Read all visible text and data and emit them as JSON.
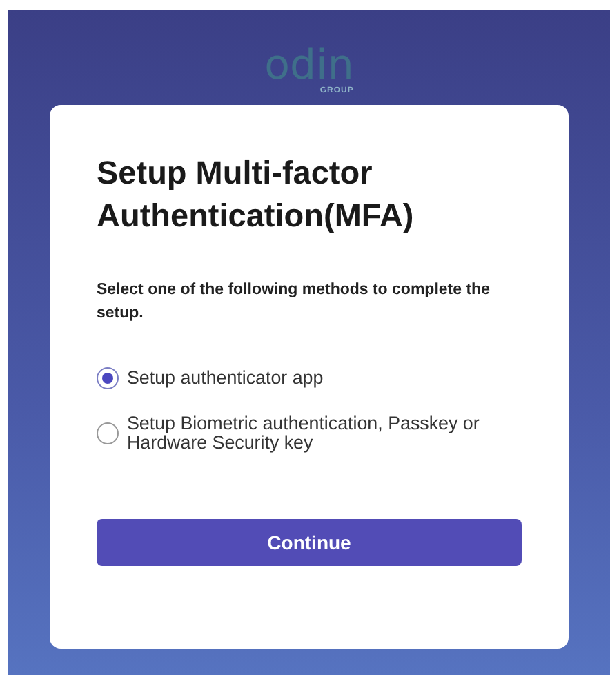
{
  "logo": {
    "text": "odin",
    "subtext": "GROUP"
  },
  "title": "Setup Multi-factor Authentication(MFA)",
  "instruction": "Select one of the following methods to complete the setup.",
  "options": [
    {
      "label": "Setup authenticator app",
      "selected": true
    },
    {
      "label": "Setup Biometric authentication, Passkey or Hardware Security key",
      "selected": false
    }
  ],
  "button": "Continue"
}
